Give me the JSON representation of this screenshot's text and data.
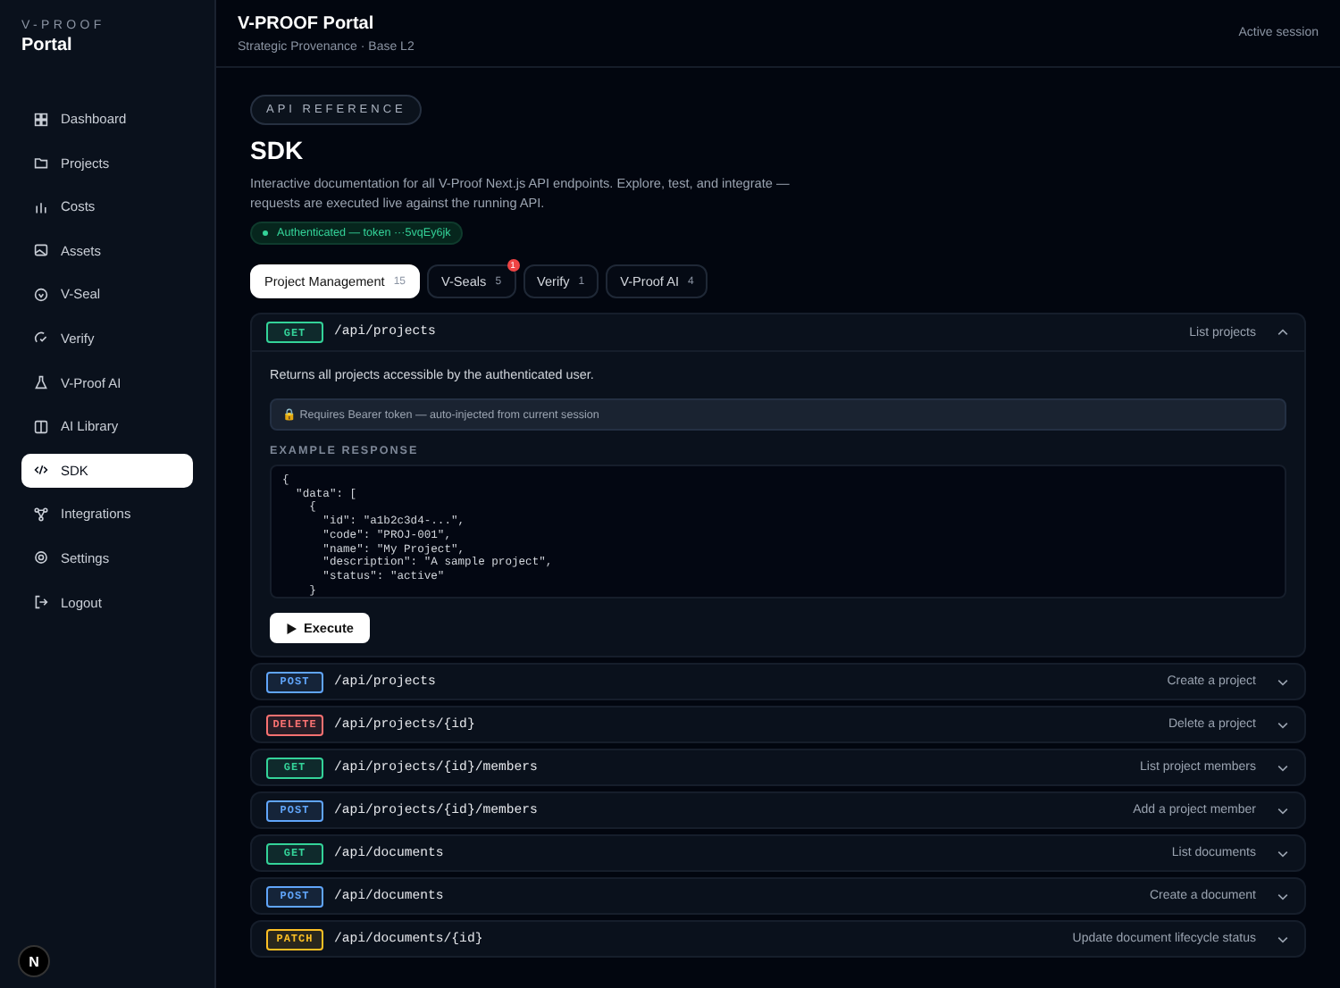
{
  "sidebar": {
    "brand": "V-PROOF",
    "title": "Portal",
    "items": [
      {
        "label": "Dashboard",
        "selected": false
      },
      {
        "label": "Projects",
        "selected": false
      },
      {
        "label": "Costs",
        "selected": false
      },
      {
        "label": "Assets",
        "selected": false
      },
      {
        "label": "V-Seal",
        "selected": false
      },
      {
        "label": "Verify",
        "selected": false
      },
      {
        "label": "V-Proof AI",
        "selected": false
      },
      {
        "label": "AI Library",
        "selected": false
      },
      {
        "label": "SDK",
        "selected": true
      },
      {
        "label": "Integrations",
        "selected": false
      },
      {
        "label": "Settings",
        "selected": false
      },
      {
        "label": "Logout",
        "selected": false
      }
    ],
    "dev_badge": "N"
  },
  "header": {
    "title": "V-PROOF Portal",
    "subtitle": "Strategic Provenance · Base L2",
    "session": "Active session"
  },
  "page": {
    "eyebrow": "API REFERENCE",
    "title": "SDK",
    "description": "Interactive documentation for all V-Proof Next.js API endpoints. Explore, test, and integrate — requests are executed live against the running API.",
    "auth": "Authenticated — token ···5vqEy6jk"
  },
  "tabs": [
    {
      "label": "Project Management",
      "count": "15",
      "selected": true
    },
    {
      "label": "V-Seals",
      "count": "5",
      "selected": false,
      "badge": "1"
    },
    {
      "label": "Verify",
      "count": "1",
      "selected": false
    },
    {
      "label": "V-Proof AI",
      "count": "4",
      "selected": false
    }
  ],
  "endpoints": [
    {
      "method": "GET",
      "color": "#34d399",
      "path": "/api/projects",
      "summary": "List projects",
      "expanded": true,
      "details": {
        "description": "Returns all projects accessible by the authenticated user.",
        "auth_note": "🔒 Requires Bearer token — auto-injected from current session",
        "example_label": "EXAMPLE RESPONSE",
        "example": "{\n  \"data\": [\n    {\n      \"id\": \"a1b2c3d4-...\",\n      \"code\": \"PROJ-001\",\n      \"name\": \"My Project\",\n      \"description\": \"A sample project\",\n      \"status\": \"active\"\n    }",
        "action": "Execute"
      }
    },
    {
      "method": "POST",
      "color": "#60a5fa",
      "path": "/api/projects",
      "summary": "Create a project",
      "expanded": false
    },
    {
      "method": "DELETE",
      "color": "#f87171",
      "path": "/api/projects/{id}",
      "summary": "Delete a project",
      "expanded": false
    },
    {
      "method": "GET",
      "color": "#34d399",
      "path": "/api/projects/{id}/members",
      "summary": "List project members",
      "expanded": false
    },
    {
      "method": "POST",
      "color": "#60a5fa",
      "path": "/api/projects/{id}/members",
      "summary": "Add a project member",
      "expanded": false
    },
    {
      "method": "GET",
      "color": "#34d399",
      "path": "/api/documents",
      "summary": "List documents",
      "expanded": false
    },
    {
      "method": "POST",
      "color": "#60a5fa",
      "path": "/api/documents",
      "summary": "Create a document",
      "expanded": false
    },
    {
      "method": "PATCH",
      "color": "#fbbf24",
      "path": "/api/documents/{id}",
      "summary": "Update document lifecycle status",
      "expanded": false
    }
  ]
}
